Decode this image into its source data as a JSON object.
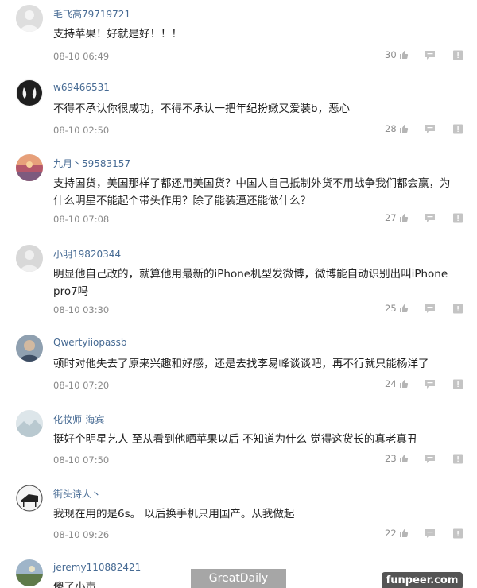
{
  "comments": [
    {
      "user": "毛飞高79719721",
      "text": "支持苹果！好就是好！！！",
      "time": "08-10 06:49",
      "likes": "30",
      "avatar_color": "#dcdcdc"
    },
    {
      "user": "w69466531",
      "text": "不得不承认你很成功，不得不承认一把年纪扮嫩又爱装b，恶心",
      "time": "08-10 02:50",
      "likes": "28",
      "avatar_color": "#2a2a2a"
    },
    {
      "user": "九月丶59583157",
      "text": "支持国货，美国那样了都还用美国货？中国人自己抵制外货不用战争我们都会赢，为什么明星不能起个带头作用？除了能装逼还能做什么？",
      "time": "08-10 07:08",
      "likes": "27",
      "avatar_color": "#c96a5a"
    },
    {
      "user": "小明19820344",
      "text": "明显他自己改的，就算他用最新的iPhone机型发微博，微博能自动识别出叫iPhone pro7吗",
      "time": "08-10 03:30",
      "likes": "25",
      "avatar_color": "#d8d8d8"
    },
    {
      "user": "Qwertyiiopassb",
      "text": "顿时对他失去了原来兴趣和好感，还是去找李易峰谈谈吧，再不行就只能杨洋了",
      "time": "08-10 07:20",
      "likes": "24",
      "avatar_color": "#6d7c8c"
    },
    {
      "user": "化妆师-海宾",
      "text": "挺好个明星艺人 至从看到他晒苹果以后 不知道为什么 觉得这货长的真老真丑",
      "time": "08-10 07:50",
      "likes": "23",
      "avatar_color": "#cfd8dc"
    },
    {
      "user": "街头诗人丶",
      "text": "我现在用的是6s。 以后换手机只用国产。从我做起",
      "time": "08-10 09:26",
      "likes": "22",
      "avatar_color": "#f2f2f2"
    },
    {
      "user": "jeremy110882421",
      "text": "傻了小声",
      "time": "",
      "likes": "",
      "avatar_color": "#7d8f6a"
    }
  ],
  "watermarks": {
    "left": "GreatDaily",
    "right": "funpeer.com"
  },
  "icons": {
    "like": "thumbs-up-icon",
    "reply": "comment-icon",
    "more": "more-icon"
  }
}
